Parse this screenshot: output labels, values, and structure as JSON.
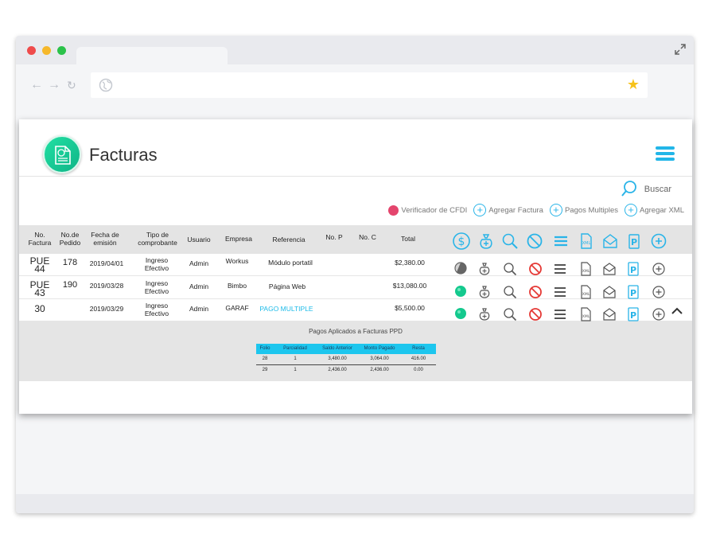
{
  "app": {
    "title": "Facturas",
    "search_label": "Buscar",
    "actions": [
      {
        "label": "Verificador de CFDI"
      },
      {
        "label": "Agregar Factura"
      },
      {
        "label": "Pagos Multiples"
      },
      {
        "label": "Agregar XML"
      }
    ],
    "accent_color": "#29b4e8",
    "brand_color": "#1fd39b"
  },
  "table": {
    "headers": {
      "no_factura": "No. Factura",
      "no_pedido": "No.de Pedido",
      "fecha": "Fecha de emisión",
      "tipo": "Tipo de comprobante",
      "usuario": "Usuario",
      "empresa": "Empresa",
      "referencia": "Referencia",
      "no_p": "No. P",
      "no_c": "No. C",
      "total": "Total"
    },
    "header_icons": [
      "dollar-circle-icon",
      "money-bag-icon",
      "search-icon",
      "cancel-icon",
      "list-icon",
      "xml-file-icon",
      "envelope-icon",
      "parking-icon",
      "add-circle-icon"
    ],
    "rows": [
      {
        "factura": "PUE 44",
        "pedido": "178",
        "fecha": "2019/04/01",
        "tipo": "Ingreso Efectivo",
        "usuario": "Admin",
        "empresa": "Workus",
        "referencia": "Módulo portatil",
        "total": "$2,380.00",
        "status": "partial"
      },
      {
        "factura": "PUE 43",
        "pedido": "190",
        "fecha": "2019/03/28",
        "tipo": "Ingreso Efectivo",
        "usuario": "Admin",
        "empresa": "Bimbo",
        "referencia": "Página Web",
        "total": "$13,080.00",
        "status": "paid"
      },
      {
        "factura": "30",
        "pedido": "",
        "fecha": "2019/03/29",
        "tipo": "Ingreso Efectivo",
        "usuario": "Admin",
        "empresa": "GARAF",
        "referencia": "PAGO MULTIPLE",
        "total": "$5,500.00",
        "status": "paid"
      }
    ]
  },
  "detail": {
    "title": "Pagos Aplicados a Facturas PPD",
    "headers": [
      "Folio",
      "Parcialidad",
      "Saldo Anterior",
      "Monto Pagado",
      "Resta"
    ],
    "rows": [
      [
        "28",
        "1",
        "3,480.00",
        "3,064.00",
        "416.00"
      ],
      [
        "29",
        "1",
        "2,436.00",
        "2,436.00",
        "0.00"
      ]
    ]
  }
}
